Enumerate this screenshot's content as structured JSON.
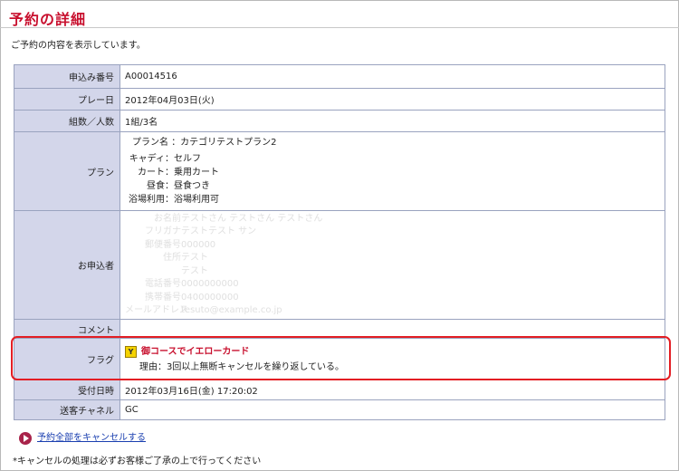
{
  "page": {
    "title": "予約の詳細",
    "intro": "ご予約の内容を表示しています。"
  },
  "rows": {
    "application_no": {
      "label": "申込み番号",
      "value": "A00014516"
    },
    "play_date": {
      "label": "プレー日",
      "value": "2012年04月03日(火)"
    },
    "groups": {
      "label": "組数／人数",
      "value": "1組/3名"
    },
    "plan": {
      "label": "プラン",
      "plan_name_key": "プラン名",
      "plan_name_value": "：カテゴリテストプラン2",
      "items": [
        {
          "key": "キャディ",
          "value": "：セルフ"
        },
        {
          "key": "カート",
          "value": "：乗用カート"
        },
        {
          "key": "昼食",
          "value": "：昼食つき"
        },
        {
          "key": "浴場利用",
          "value": "：浴場利用可"
        }
      ]
    },
    "applicant": {
      "label": "お申込者",
      "items": [
        {
          "key": "お名前",
          "value": "テストさん テストさん テストさん"
        },
        {
          "key": "フリガナ",
          "value": "テストテスト サン"
        },
        {
          "key": "郵便番号",
          "value": "000000"
        },
        {
          "key": "住所",
          "value": "テスト"
        },
        {
          "key": "",
          "value": "テスト"
        },
        {
          "key": "電話番号",
          "value": "0000000000"
        },
        {
          "key": "携帯番号",
          "value": "0400000000"
        },
        {
          "key": "メールアドレス",
          "value": "tesuto@example.co.jp"
        }
      ]
    },
    "comment": {
      "label": "コメント",
      "value": ""
    },
    "flag": {
      "label": "フラグ",
      "icon_letter": "Y",
      "title": "御コースでイエローカード",
      "reason": "理由：3回以上無断キャンセルを繰り返している。",
      "highlight_color": "#e31e24"
    },
    "received": {
      "label": "受付日時",
      "value": "2012年03月16日(金) 17:20:02"
    },
    "channel": {
      "label": "送客チャネル",
      "value": "GC"
    }
  },
  "cancel_link": "予約全部をキャンセルする",
  "note": "*キャンセルの処理は必ずお客様ご了承の上で行ってください",
  "colors": {
    "title_red": "#c8102e",
    "label_bg": "#d3d6ea",
    "border": "#9aa3bf",
    "link_blue": "#1a3fb0",
    "icon_yellow": "#f5d300",
    "play_icon": "#a8234a"
  }
}
